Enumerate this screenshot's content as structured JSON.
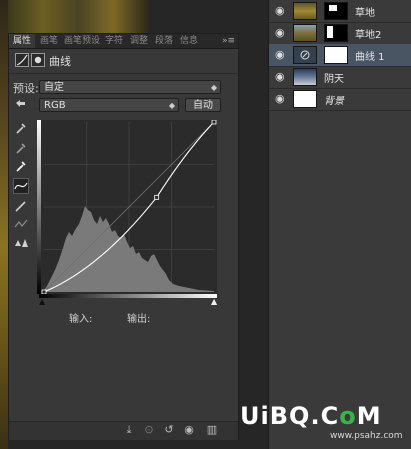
{
  "panel": {
    "tabs": [
      "属性",
      "画笔",
      "画笔预设",
      "字符",
      "调整",
      "段落",
      "信息"
    ],
    "menu_icon": "»≡",
    "adjustment_title": "曲线",
    "preset_label": "预设:",
    "preset_value": "自定",
    "channel_value": "RGB",
    "auto_button": "自动",
    "input_label": "输入:",
    "output_label": "输出:",
    "tools": [
      "on-image-adjust-icon",
      "black-point-eyedropper-icon",
      "gray-point-eyedropper-icon",
      "white-point-eyedropper-icon",
      "curve-edit-icon",
      "pencil-draw-icon",
      "smooth-curve-icon",
      "clipping-warning-icon"
    ],
    "bottom_icons": [
      "clip-to-layer-icon",
      "view-previous-icon",
      "reset-icon",
      "visibility-icon",
      "delete-icon"
    ]
  },
  "curve": {
    "points": [
      [
        0,
        0
      ],
      [
        169,
        142
      ],
      [
        255,
        255
      ]
    ],
    "range": [
      0,
      255
    ]
  },
  "layers": {
    "items": [
      {
        "name": "草地",
        "selected": false,
        "italic": false
      },
      {
        "name": "草地2",
        "selected": false,
        "italic": false
      },
      {
        "name": "曲线 1",
        "selected": true,
        "italic": false
      },
      {
        "name": "阴天",
        "selected": false,
        "italic": false
      },
      {
        "name": "背景",
        "selected": false,
        "italic": true
      }
    ]
  },
  "watermark": {
    "brand_u": "U",
    "brand_i": "i",
    "brand_b": "B",
    "brand_q": "Q",
    "brand_dot": ".",
    "brand_c": "C",
    "brand_o": "o",
    "brand_m": "M",
    "url": "www.psahz.com"
  },
  "colors": {
    "panel_bg": "#383838",
    "selected_layer": "#4a5564",
    "watermark_green": "#3cb34a"
  }
}
